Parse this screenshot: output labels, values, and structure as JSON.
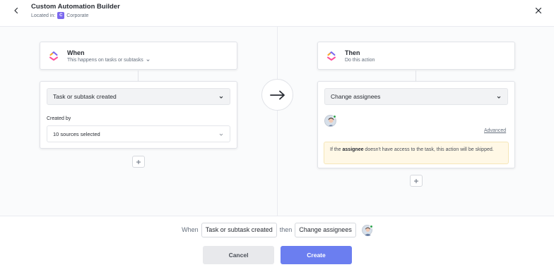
{
  "header": {
    "title": "Custom Automation Builder",
    "located_label": "Located in:",
    "space_initial": "C",
    "space_name": "Corporate",
    "space_color": "#7b68ee"
  },
  "trigger": {
    "title": "When",
    "subtitle": "This happens on tasks or subtasks",
    "event": "Task or subtask created",
    "created_by_label": "Created by",
    "sources": "10 sources selected"
  },
  "action": {
    "title": "Then",
    "subtitle": "Do this action",
    "event": "Change assignees",
    "advanced": "Advanced",
    "warning_prefix": "If the ",
    "warning_bold": "assignee",
    "warning_suffix": " doesn't have access to the task, this action will be skipped."
  },
  "summary": {
    "when": "When",
    "trigger": "Task or subtask created",
    "then": "then",
    "action": "Change assignees"
  },
  "buttons": {
    "cancel": "Cancel",
    "create": "Create"
  },
  "colors": {
    "accent": "#6b7ef0",
    "warning_bg": "#fff8e6",
    "online": "#2ea44f"
  },
  "icons": [
    "back-arrow-icon",
    "close-icon",
    "clickup-logo-icon",
    "chevron-down-icon",
    "plus-icon",
    "right-arrow-icon",
    "avatar"
  ]
}
